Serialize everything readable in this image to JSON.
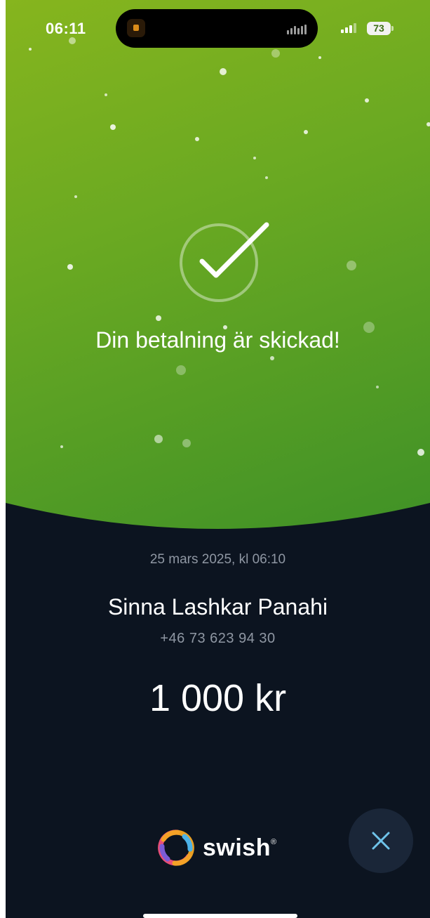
{
  "status_bar": {
    "time": "06:11",
    "battery": "73"
  },
  "confirmation": {
    "headline": "Din betalning är skickad!",
    "icon": "checkmark-circle-icon"
  },
  "payment": {
    "date": "25 mars 2025, kl 06:10",
    "recipient_name": "Sinna Lashkar Panahi",
    "recipient_phone": "+46 73 623 94 30",
    "amount": "1 000 kr"
  },
  "footer": {
    "logo_text": "swish",
    "logo_mark": "®",
    "close_icon": "close-icon"
  },
  "colors": {
    "hero_green_start": "#86b51e",
    "hero_green_end": "#3f9127",
    "background_dark": "#0c1420",
    "close_button_bg": "#1a2638",
    "close_icon_color": "#6fc3ea"
  }
}
